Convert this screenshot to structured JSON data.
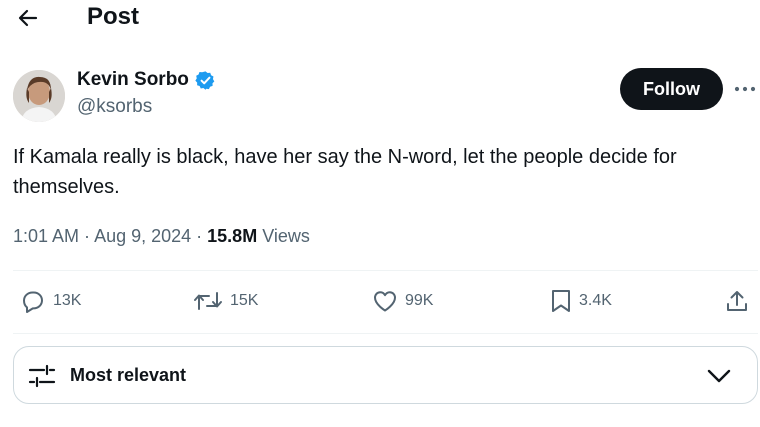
{
  "header": {
    "title": "Post",
    "back_icon": "arrow-left-icon"
  },
  "author": {
    "name": "Kevin Sorbo",
    "handle": "@ksorbs",
    "verified": true,
    "verified_color": "#1d9bf0"
  },
  "follow_button": {
    "label": "Follow"
  },
  "more_icon": "ellipsis-icon",
  "tweet": {
    "text": "If Kamala really is black, have her say the N-word, let the people decide for themselves."
  },
  "meta": {
    "time": "1:01 AM",
    "separator1": " · ",
    "date": "Aug 9, 2024",
    "separator2": " · ",
    "views_count": "15.8M",
    "views_label": " Views"
  },
  "actions": {
    "replies": {
      "icon": "reply-icon",
      "count": "13K"
    },
    "reposts": {
      "icon": "repost-icon",
      "count": "15K"
    },
    "likes": {
      "icon": "heart-icon",
      "count": "99K"
    },
    "bookmarks": {
      "icon": "bookmark-icon",
      "count": "3.4K"
    },
    "share": {
      "icon": "share-icon"
    }
  },
  "sort": {
    "label": "Most relevant",
    "icon": "sliders-icon",
    "chevron": "chevron-down-icon"
  },
  "colors": {
    "text_primary": "#0f1419",
    "text_secondary": "#536471",
    "divider": "#eff3f4",
    "accent": "#1d9bf0"
  }
}
